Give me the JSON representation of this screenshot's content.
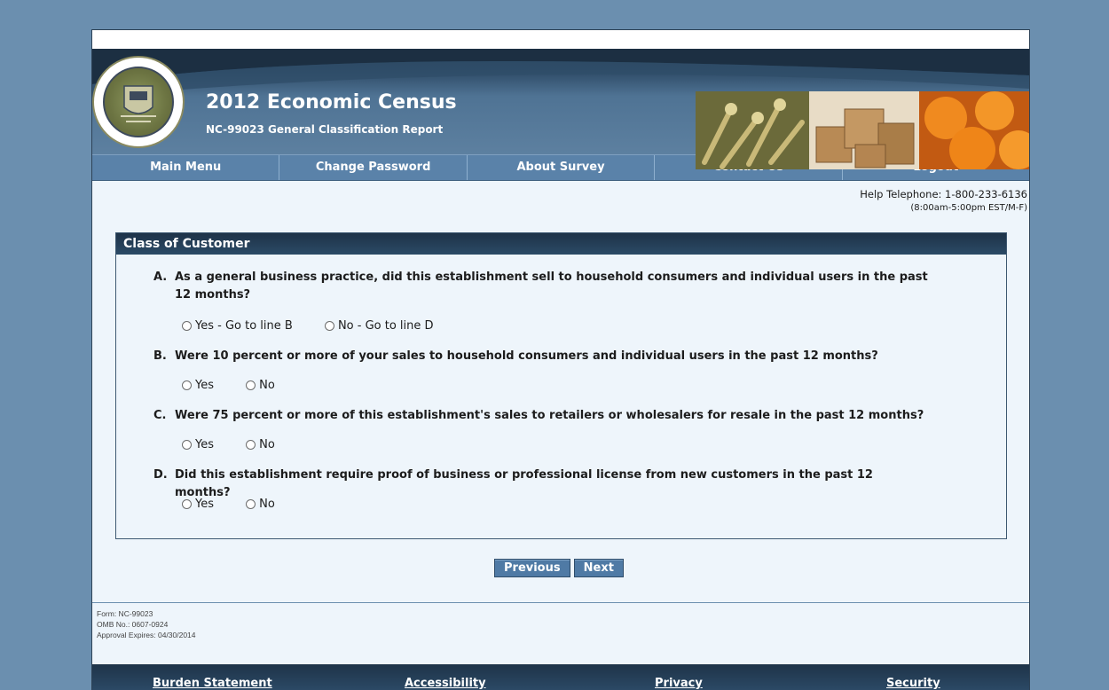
{
  "header": {
    "title": "2012 Economic Census",
    "subtitle": "NC-99023 General Classification Report",
    "seal_label": "U.S. DEPARTMENT OF COMMERCE · BUREAU OF THE CENSUS"
  },
  "nav": {
    "items": [
      "Main Menu",
      "Change Password",
      "About Survey",
      "Contact Us",
      "Logout"
    ]
  },
  "help": {
    "telephone": "Help Telephone: 1-800-233-6136",
    "hours": "(8:00am-5:00pm EST/M-F)"
  },
  "section": {
    "title": "Class of Customer",
    "questions": [
      {
        "letter": "A.",
        "text": "As a general business practice, did this establishment sell to household consumers and individual users in the past 12 months?",
        "options": [
          "Yes - Go to line B",
          "No - Go to line D"
        ]
      },
      {
        "letter": "B.",
        "text": "Were 10 percent or more of your sales to household consumers and individual users in the past 12 months?",
        "options": [
          "Yes",
          "No"
        ]
      },
      {
        "letter": "C.",
        "text": "Were 75 percent or more of this establishment's sales to retailers or wholesalers for resale in the past 12 months?",
        "options": [
          "Yes",
          "No"
        ]
      },
      {
        "letter": "D.",
        "text": "Did this establishment require proof of business or professional license from new customers in the past 12 months?",
        "options": [
          "Yes",
          "No"
        ]
      }
    ]
  },
  "buttons": {
    "previous": "Previous",
    "next": "Next"
  },
  "form_info": {
    "form": "Form: NC-99023",
    "omb": "OMB No.: 0607-0924",
    "expires": "Approval Expires: 04/30/2014"
  },
  "footer": {
    "links": [
      "Burden Statement",
      "Accessibility",
      "Privacy",
      "Security"
    ]
  },
  "colors": {
    "background": "#6b8faf",
    "nav": "#5a82a9",
    "panel_header": "#1e3348",
    "button": "#4f7aa5"
  }
}
